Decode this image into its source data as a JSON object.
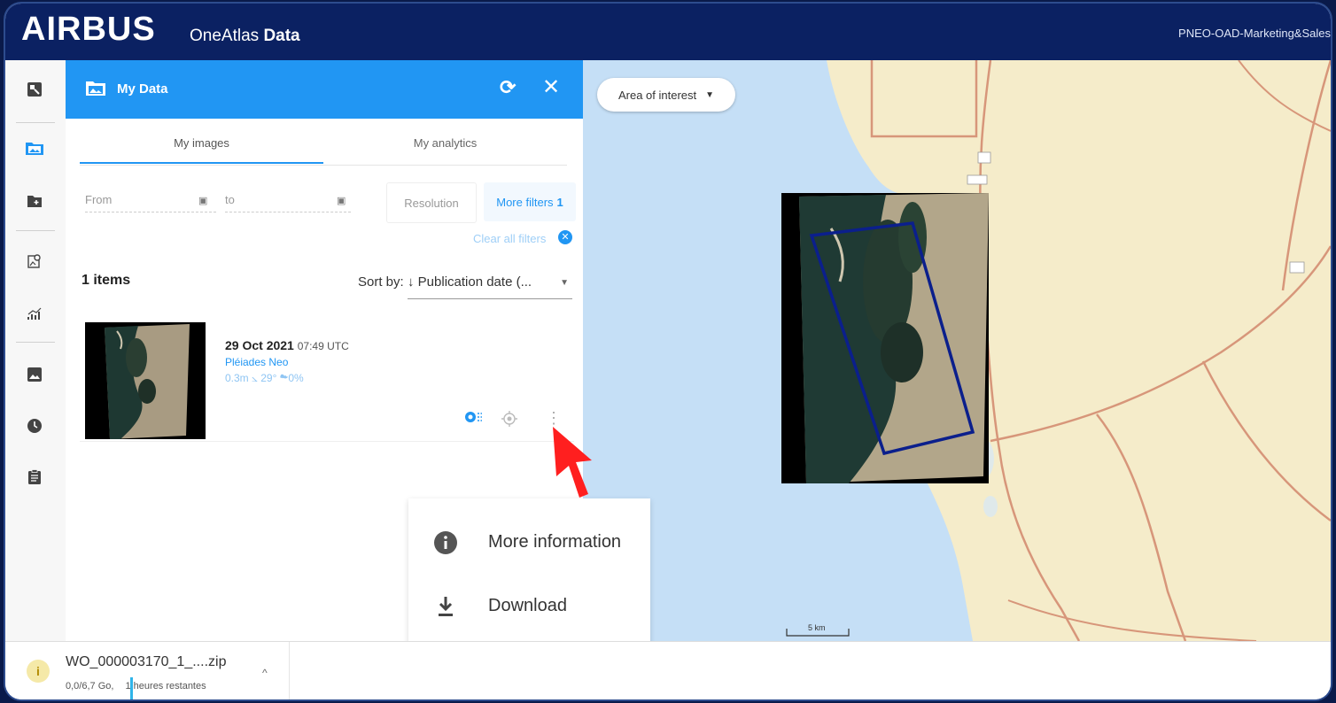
{
  "header": {
    "logo": "AIRBUS",
    "product_prefix": "OneAtlas ",
    "product_bold": "Data",
    "user": "PNEO-OAD-Marketing&Sales"
  },
  "panel": {
    "title": "My Data",
    "tabs": [
      {
        "label": "My images",
        "active": true
      },
      {
        "label": "My analytics",
        "active": false
      }
    ],
    "filters": {
      "from_placeholder": "From",
      "to_placeholder": "to",
      "resolution": "Resolution",
      "more_filters": "More filters",
      "more_filters_count": "1",
      "clear_all": "Clear all filters"
    },
    "count": "1 items",
    "sort_label": "Sort by:",
    "sort_value": "↓ Publication date (...",
    "items": [
      {
        "date": "29 Oct 2021",
        "time": "07:49 UTC",
        "sensor": "Pléiades Neo",
        "meta": "0.3m  ⦣ 29°  ☁0%"
      }
    ]
  },
  "map": {
    "aoi_label": "Area of interest",
    "scale": "5 km"
  },
  "context_menu": {
    "items": [
      {
        "label": "More information",
        "icon": "info-icon"
      },
      {
        "label": "Download",
        "icon": "download-icon"
      }
    ]
  },
  "download_bar": {
    "file_name": "WO_000003170_1_....zip",
    "size": "0,0/6,7 Go,",
    "eta": "1 heures restantes"
  },
  "colors": {
    "header": "#0b2162",
    "accent": "#2196f3",
    "map_land": "#f5ecca",
    "map_water": "#c5dff6",
    "road": "#d7967a",
    "aoi_outline": "#0b1f8c"
  }
}
